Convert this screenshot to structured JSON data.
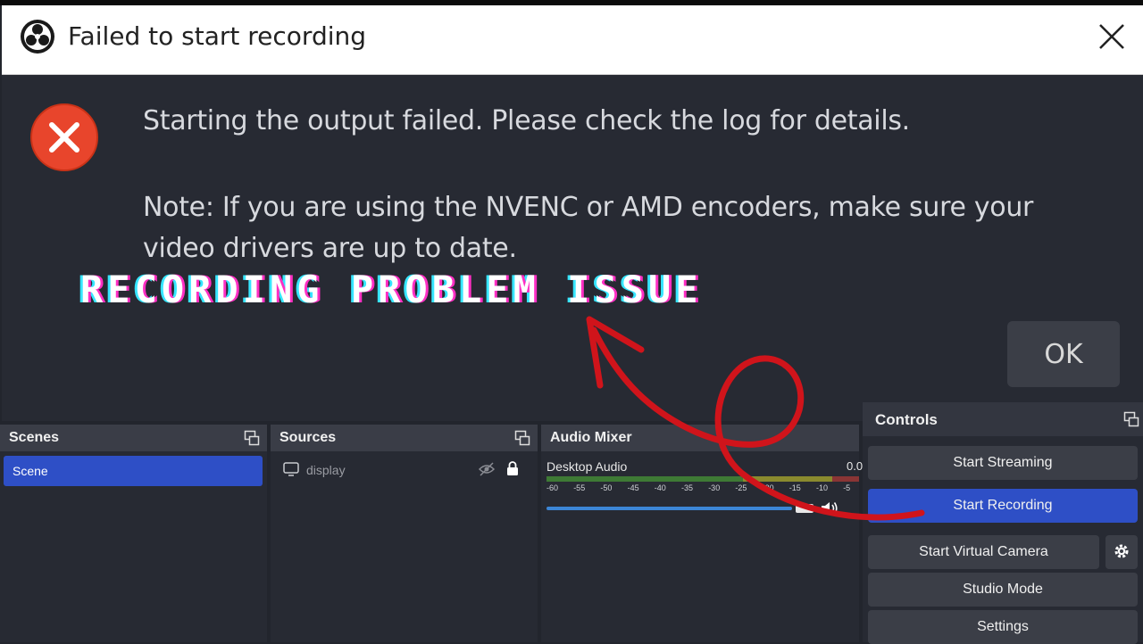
{
  "dialog": {
    "title": "Failed to start recording",
    "message": "Starting the output failed. Please check the log for details.",
    "note": "Note: If you are using the NVENC or AMD encoders, make sure your video drivers are up to date.",
    "ok_label": "OK"
  },
  "overlay_text": "RECORDING PROBLEM ISSUE",
  "panels": {
    "scenes": {
      "title": "Scenes",
      "items": [
        "Scene"
      ]
    },
    "sources": {
      "title": "Sources",
      "items": [
        "display"
      ]
    },
    "mixer": {
      "title": "Audio Mixer",
      "track": "Desktop Audio",
      "db": "0.0",
      "ticks": [
        "-60",
        "-55",
        "-50",
        "-45",
        "-40",
        "-35",
        "-30",
        "-25",
        "-20",
        "-15",
        "-10",
        "-5"
      ]
    },
    "controls": {
      "title": "Controls",
      "start_streaming": "Start Streaming",
      "start_recording": "Start Recording",
      "start_virtual_camera": "Start Virtual Camera",
      "studio_mode": "Studio Mode",
      "settings": "Settings"
    }
  },
  "colors": {
    "accent": "#2e4fc6",
    "error": "#e8452c",
    "annotation": "#d0141b"
  }
}
